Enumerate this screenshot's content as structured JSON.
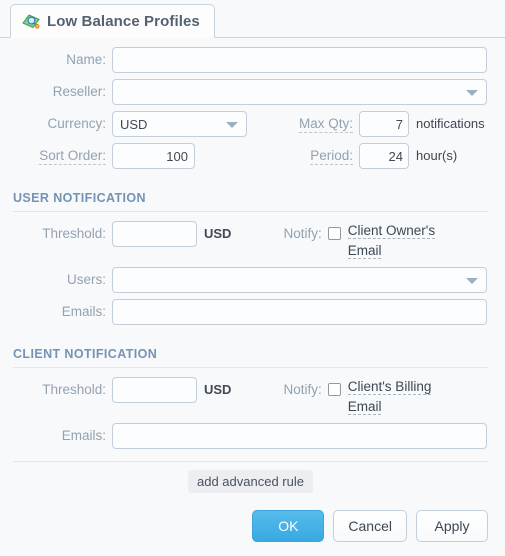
{
  "tab": {
    "icon": "money-magnifier-icon",
    "label": "Low Balance Profiles"
  },
  "form": {
    "name": {
      "label": "Name:",
      "value": "",
      "placeholder": ""
    },
    "reseller": {
      "label": "Reseller:",
      "value": "",
      "placeholder": ""
    },
    "currency": {
      "label": "Currency:",
      "value": "USD"
    },
    "max_qty": {
      "label": "Max Qty:",
      "value": "7",
      "unit": "notifications"
    },
    "sort_order": {
      "label": "Sort Order:",
      "value": "100"
    },
    "period": {
      "label": "Period:",
      "value": "24",
      "unit": "hour(s)"
    }
  },
  "user_notification": {
    "title": "USER NOTIFICATION",
    "threshold": {
      "label": "Threshold:",
      "value": "",
      "unit": "USD"
    },
    "notify": {
      "label": "Notify:",
      "checkbox_label": "Client Owner's Email",
      "checked": false
    },
    "users": {
      "label": "Users:",
      "value": ""
    },
    "emails": {
      "label": "Emails:",
      "value": "",
      "placeholder": ""
    }
  },
  "client_notification": {
    "title": "CLIENT NOTIFICATION",
    "threshold": {
      "label": "Threshold:",
      "value": "",
      "unit": "USD"
    },
    "notify": {
      "label": "Notify:",
      "checkbox_label": "Client's Billing Email",
      "checked": false
    },
    "emails": {
      "label": "Emails:",
      "value": "",
      "placeholder": ""
    }
  },
  "advanced": {
    "label": "add advanced rule"
  },
  "footer": {
    "ok": "OK",
    "cancel": "Cancel",
    "apply": "Apply"
  },
  "colors": {
    "accent": "#39a9e2",
    "section_header": "#7394b4",
    "label": "#93a2b0",
    "background": "#f8f9fb",
    "border": "#c2cfda"
  }
}
